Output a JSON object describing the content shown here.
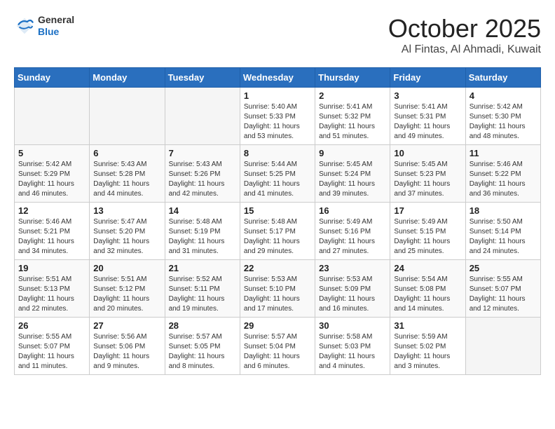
{
  "header": {
    "logo_line1": "General",
    "logo_line2": "Blue",
    "month": "October 2025",
    "location": "Al Fintas, Al Ahmadi, Kuwait"
  },
  "days_of_week": [
    "Sunday",
    "Monday",
    "Tuesday",
    "Wednesday",
    "Thursday",
    "Friday",
    "Saturday"
  ],
  "weeks": [
    [
      {
        "day": "",
        "info": ""
      },
      {
        "day": "",
        "info": ""
      },
      {
        "day": "",
        "info": ""
      },
      {
        "day": "1",
        "info": "Sunrise: 5:40 AM\nSunset: 5:33 PM\nDaylight: 11 hours\nand 53 minutes."
      },
      {
        "day": "2",
        "info": "Sunrise: 5:41 AM\nSunset: 5:32 PM\nDaylight: 11 hours\nand 51 minutes."
      },
      {
        "day": "3",
        "info": "Sunrise: 5:41 AM\nSunset: 5:31 PM\nDaylight: 11 hours\nand 49 minutes."
      },
      {
        "day": "4",
        "info": "Sunrise: 5:42 AM\nSunset: 5:30 PM\nDaylight: 11 hours\nand 48 minutes."
      }
    ],
    [
      {
        "day": "5",
        "info": "Sunrise: 5:42 AM\nSunset: 5:29 PM\nDaylight: 11 hours\nand 46 minutes."
      },
      {
        "day": "6",
        "info": "Sunrise: 5:43 AM\nSunset: 5:28 PM\nDaylight: 11 hours\nand 44 minutes."
      },
      {
        "day": "7",
        "info": "Sunrise: 5:43 AM\nSunset: 5:26 PM\nDaylight: 11 hours\nand 42 minutes."
      },
      {
        "day": "8",
        "info": "Sunrise: 5:44 AM\nSunset: 5:25 PM\nDaylight: 11 hours\nand 41 minutes."
      },
      {
        "day": "9",
        "info": "Sunrise: 5:45 AM\nSunset: 5:24 PM\nDaylight: 11 hours\nand 39 minutes."
      },
      {
        "day": "10",
        "info": "Sunrise: 5:45 AM\nSunset: 5:23 PM\nDaylight: 11 hours\nand 37 minutes."
      },
      {
        "day": "11",
        "info": "Sunrise: 5:46 AM\nSunset: 5:22 PM\nDaylight: 11 hours\nand 36 minutes."
      }
    ],
    [
      {
        "day": "12",
        "info": "Sunrise: 5:46 AM\nSunset: 5:21 PM\nDaylight: 11 hours\nand 34 minutes."
      },
      {
        "day": "13",
        "info": "Sunrise: 5:47 AM\nSunset: 5:20 PM\nDaylight: 11 hours\nand 32 minutes."
      },
      {
        "day": "14",
        "info": "Sunrise: 5:48 AM\nSunset: 5:19 PM\nDaylight: 11 hours\nand 31 minutes."
      },
      {
        "day": "15",
        "info": "Sunrise: 5:48 AM\nSunset: 5:17 PM\nDaylight: 11 hours\nand 29 minutes."
      },
      {
        "day": "16",
        "info": "Sunrise: 5:49 AM\nSunset: 5:16 PM\nDaylight: 11 hours\nand 27 minutes."
      },
      {
        "day": "17",
        "info": "Sunrise: 5:49 AM\nSunset: 5:15 PM\nDaylight: 11 hours\nand 25 minutes."
      },
      {
        "day": "18",
        "info": "Sunrise: 5:50 AM\nSunset: 5:14 PM\nDaylight: 11 hours\nand 24 minutes."
      }
    ],
    [
      {
        "day": "19",
        "info": "Sunrise: 5:51 AM\nSunset: 5:13 PM\nDaylight: 11 hours\nand 22 minutes."
      },
      {
        "day": "20",
        "info": "Sunrise: 5:51 AM\nSunset: 5:12 PM\nDaylight: 11 hours\nand 20 minutes."
      },
      {
        "day": "21",
        "info": "Sunrise: 5:52 AM\nSunset: 5:11 PM\nDaylight: 11 hours\nand 19 minutes."
      },
      {
        "day": "22",
        "info": "Sunrise: 5:53 AM\nSunset: 5:10 PM\nDaylight: 11 hours\nand 17 minutes."
      },
      {
        "day": "23",
        "info": "Sunrise: 5:53 AM\nSunset: 5:09 PM\nDaylight: 11 hours\nand 16 minutes."
      },
      {
        "day": "24",
        "info": "Sunrise: 5:54 AM\nSunset: 5:08 PM\nDaylight: 11 hours\nand 14 minutes."
      },
      {
        "day": "25",
        "info": "Sunrise: 5:55 AM\nSunset: 5:07 PM\nDaylight: 11 hours\nand 12 minutes."
      }
    ],
    [
      {
        "day": "26",
        "info": "Sunrise: 5:55 AM\nSunset: 5:07 PM\nDaylight: 11 hours\nand 11 minutes."
      },
      {
        "day": "27",
        "info": "Sunrise: 5:56 AM\nSunset: 5:06 PM\nDaylight: 11 hours\nand 9 minutes."
      },
      {
        "day": "28",
        "info": "Sunrise: 5:57 AM\nSunset: 5:05 PM\nDaylight: 11 hours\nand 8 minutes."
      },
      {
        "day": "29",
        "info": "Sunrise: 5:57 AM\nSunset: 5:04 PM\nDaylight: 11 hours\nand 6 minutes."
      },
      {
        "day": "30",
        "info": "Sunrise: 5:58 AM\nSunset: 5:03 PM\nDaylight: 11 hours\nand 4 minutes."
      },
      {
        "day": "31",
        "info": "Sunrise: 5:59 AM\nSunset: 5:02 PM\nDaylight: 11 hours\nand 3 minutes."
      },
      {
        "day": "",
        "info": ""
      }
    ]
  ]
}
